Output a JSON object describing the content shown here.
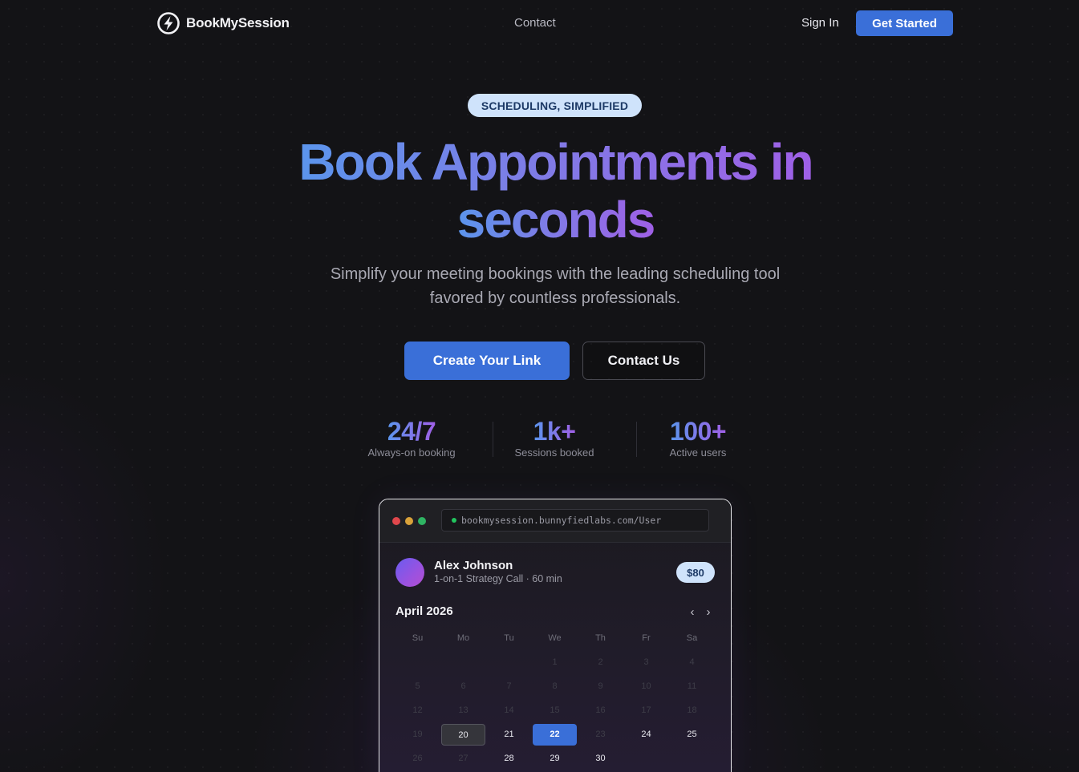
{
  "nav": {
    "brand": "BookMySession",
    "contact": "Contact",
    "sign_in": "Sign In",
    "get_started": "Get Started"
  },
  "hero": {
    "badge": "SCHEDULING, SIMPLIFIED",
    "headline_line1": "Book Appointments in",
    "headline_line2": "seconds",
    "subtitle": "Simplify your meeting bookings with the leading scheduling tool favored by countless professionals.",
    "cta_primary": "Create Your Link",
    "cta_secondary": "Contact Us"
  },
  "stats": [
    {
      "value": "24/7",
      "label": "Always-on booking"
    },
    {
      "value": "1k+",
      "label": "Sessions booked"
    },
    {
      "value": "100+",
      "label": "Active users"
    }
  ],
  "mockup": {
    "url": "bookmysession.bunnyfiedlabs.com/User",
    "host_name": "Alex Johnson",
    "session": "1-on-1 Strategy Call · 60 min",
    "price": "$80",
    "month": "April 2026",
    "prev_icon": "‹",
    "next_icon": "›",
    "weekdays": [
      "Su",
      "Mo",
      "Tu",
      "We",
      "Th",
      "Fr",
      "Sa"
    ],
    "weeks": [
      [
        "",
        "",
        "",
        "1",
        "2",
        "3",
        "4"
      ],
      [
        "5",
        "6",
        "7",
        "8",
        "9",
        "10",
        "11"
      ],
      [
        "12",
        "13",
        "14",
        "15",
        "16",
        "17",
        "18"
      ],
      [
        "19",
        "20",
        "21",
        "22",
        "23",
        "24",
        "25"
      ],
      [
        "26",
        "27",
        "28",
        "29",
        "30",
        "",
        ""
      ]
    ],
    "today": "20",
    "selected": "22",
    "available": [
      "20",
      "21",
      "22",
      "24",
      "25",
      "28",
      "29",
      "30"
    ],
    "window_dot_colors": [
      "#e0474c",
      "#d9a23a",
      "#2fb463"
    ]
  },
  "colors": {
    "accent": "#3a6fd8",
    "gradient_start": "#5b95ec",
    "gradient_end": "#a05fe6",
    "badge_bg": "#cfe3fb"
  }
}
